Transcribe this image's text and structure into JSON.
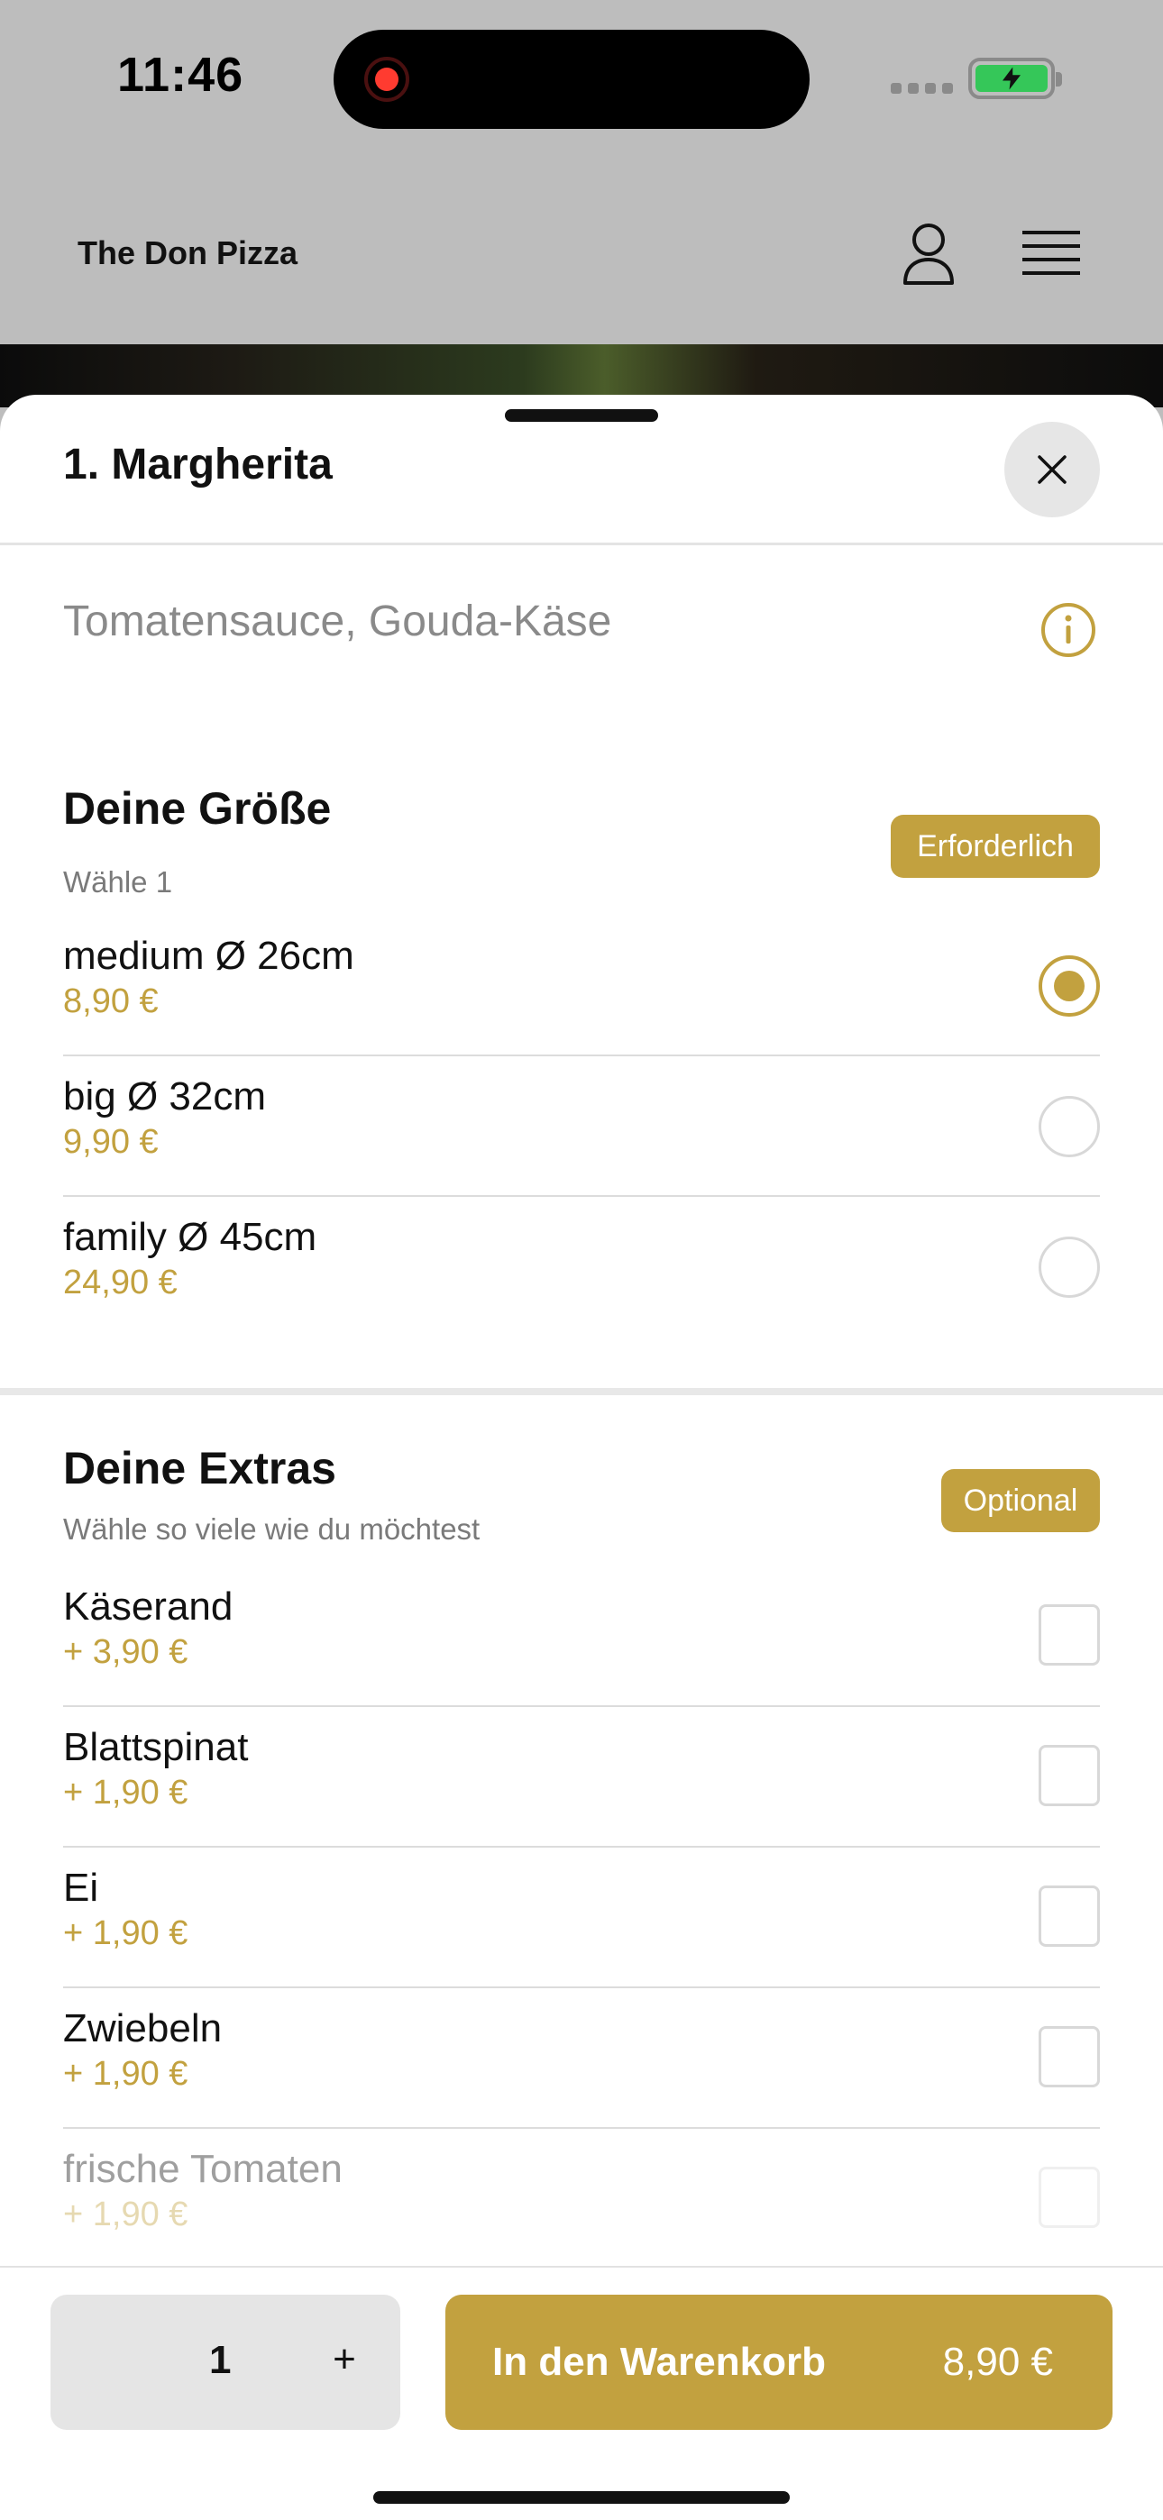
{
  "status_bar": {
    "time": "11:46"
  },
  "header": {
    "brand": "The Don Pizza"
  },
  "sheet": {
    "title": "1. Margherita",
    "description": "Tomatensauce, Gouda-Käse"
  },
  "size_group": {
    "title": "Deine Größe",
    "subtitle": "Wähle 1",
    "badge": "Erforderlich",
    "options": [
      {
        "name": "medium Ø 26cm",
        "price": "8,90 €",
        "selected": true
      },
      {
        "name": "big Ø 32cm",
        "price": "9,90 €",
        "selected": false
      },
      {
        "name": "family Ø 45cm",
        "price": "24,90 €",
        "selected": false
      }
    ]
  },
  "extras_group": {
    "title": "Deine Extras",
    "subtitle": "Wähle so viele wie du möchtest",
    "badge": "Optional",
    "options": [
      {
        "name": "Käserand",
        "price": "+ 3,90 €",
        "checked": false
      },
      {
        "name": "Blattspinat",
        "price": "+ 1,90 €",
        "checked": false
      },
      {
        "name": "Ei",
        "price": "+ 1,90 €",
        "checked": false
      },
      {
        "name": "Zwiebeln",
        "price": "+ 1,90 €",
        "checked": false
      },
      {
        "name": "frische Tomaten",
        "price": "+ 1,90 €",
        "checked": false
      }
    ]
  },
  "bottom_bar": {
    "quantity": "1",
    "plus": "+",
    "cart_label": "In den Warenkorb",
    "cart_price": "8,90 €"
  },
  "colors": {
    "accent": "#c2a13f",
    "overlay": "#bdbdbd"
  }
}
